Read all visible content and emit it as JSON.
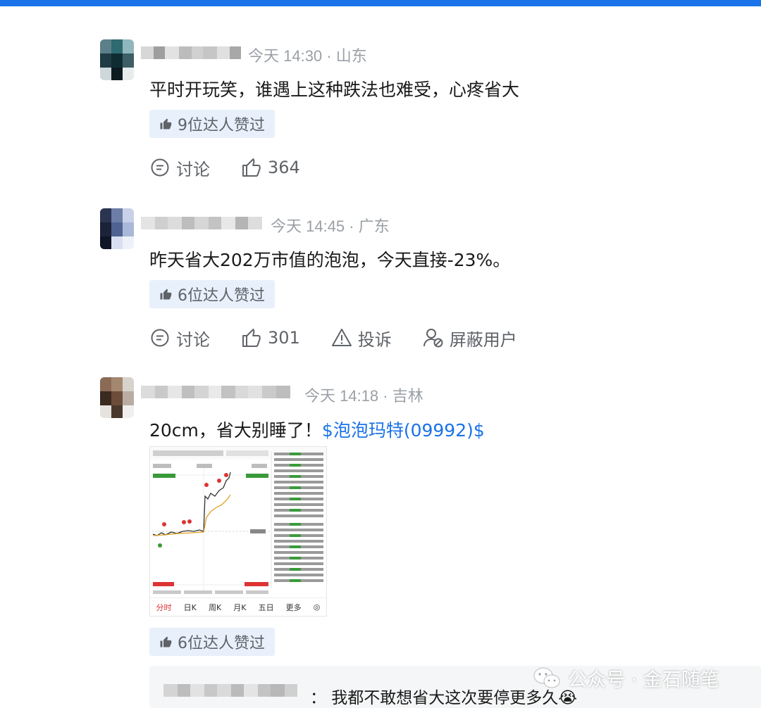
{
  "colors": {
    "accent": "#1a73e8",
    "badge_bg": "#e8f0fc",
    "muted": "#9aa0a6"
  },
  "comments": [
    {
      "meta": "今天 14:30 · 山东",
      "text": "平时开玩笑，谁遇上这种跌法也难受，心疼省大",
      "badge": "9位达人赞过",
      "actions": {
        "discuss": "讨论",
        "likes": "364"
      }
    },
    {
      "meta": "今天 14:45 · 广东",
      "text": "昨天省大202万市值的泡泡，今天直接-23%。",
      "badge": "6位达人赞过",
      "actions": {
        "discuss": "讨论",
        "likes": "301",
        "report": "投诉",
        "block": "屏蔽用户"
      }
    },
    {
      "meta": "今天 14:18 · 吉林",
      "text": "20cm，省大别睡了！",
      "stock": "$泡泡玛特(09992)$",
      "badge": "6位达人赞过",
      "chart_tabs": [
        "分时",
        "日K",
        "周K",
        "月K",
        "五日",
        "更多",
        "◎"
      ]
    }
  ],
  "reply": {
    "text": "：  我都不敢想省大这次要停更多久😭"
  },
  "watermark": {
    "text": "公众号 · 金石随笔",
    "icon": "wechat-icon"
  }
}
